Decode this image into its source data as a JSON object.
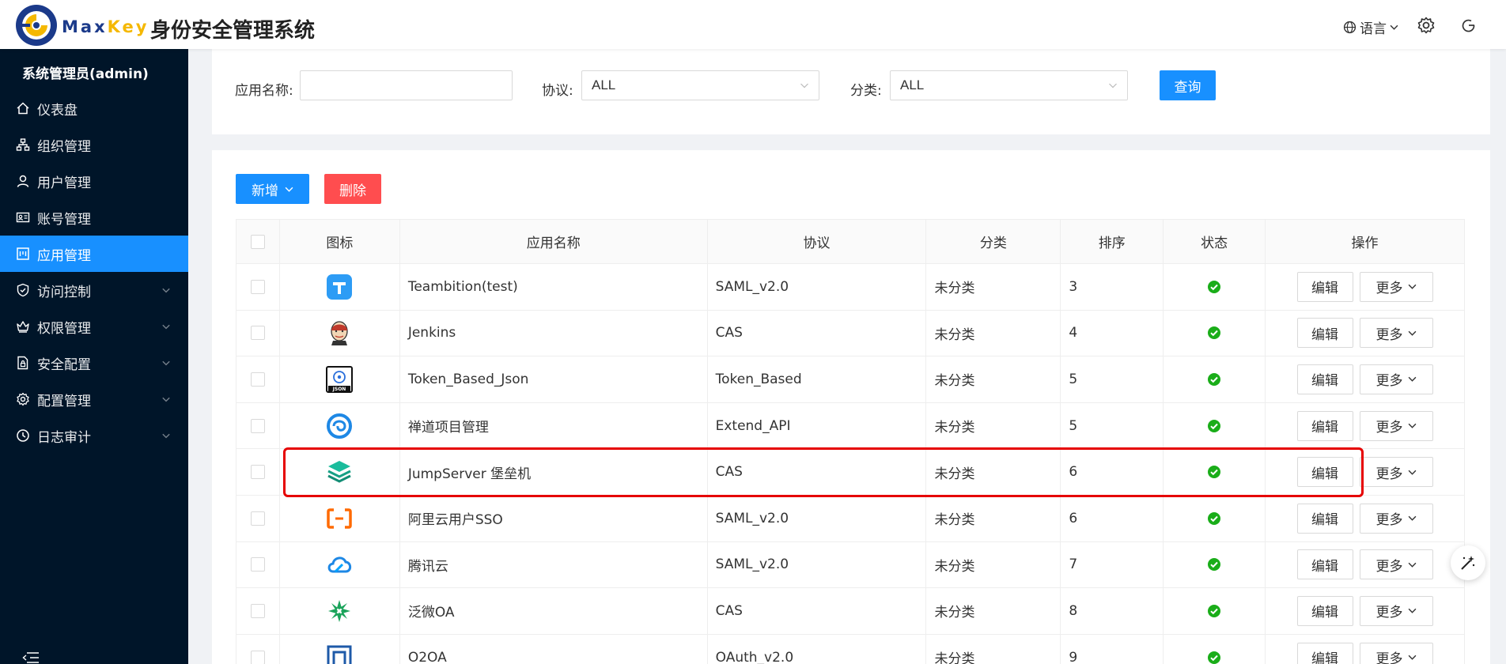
{
  "header": {
    "brand_max": "Max",
    "brand_key": "Key",
    "app_title": "身份安全管理系统",
    "language_label": "语言",
    "icons": [
      "globe-icon",
      "gear-icon",
      "logout-icon"
    ]
  },
  "sidebar": {
    "user": "系统管理员(admin)",
    "items": [
      {
        "label": "仪表盘",
        "icon": "home-icon",
        "expandable": false,
        "active": false
      },
      {
        "label": "组织管理",
        "icon": "org-icon",
        "expandable": false,
        "active": false
      },
      {
        "label": "用户管理",
        "icon": "user-icon",
        "expandable": false,
        "active": false
      },
      {
        "label": "账号管理",
        "icon": "idcard-icon",
        "expandable": false,
        "active": false
      },
      {
        "label": "应用管理",
        "icon": "app-icon",
        "expandable": false,
        "active": true
      },
      {
        "label": "访问控制",
        "icon": "shield-icon",
        "expandable": true,
        "active": false
      },
      {
        "label": "权限管理",
        "icon": "crown-icon",
        "expandable": true,
        "active": false
      },
      {
        "label": "安全配置",
        "icon": "file-lock-icon",
        "expandable": true,
        "active": false
      },
      {
        "label": "配置管理",
        "icon": "gear-icon",
        "expandable": true,
        "active": false
      },
      {
        "label": "日志审计",
        "icon": "clock-icon",
        "expandable": true,
        "active": false
      }
    ]
  },
  "search": {
    "app_name_label": "应用名称:",
    "app_name_value": "",
    "protocol_label": "协议:",
    "protocol_value": "ALL",
    "category_label": "分类:",
    "category_value": "ALL",
    "query_button": "查询"
  },
  "toolbar": {
    "add_button": "新增",
    "delete_button": "删除"
  },
  "table": {
    "headers": [
      "",
      "图标",
      "应用名称",
      "协议",
      "分类",
      "排序",
      "状态",
      "操作"
    ],
    "edit_label": "编辑",
    "more_label": "更多",
    "rows": [
      {
        "name": "Teambition(test)",
        "protocol": "SAML_v2.0",
        "category": "未分类",
        "sort": "3",
        "icon": "teambition-icon"
      },
      {
        "name": "Jenkins",
        "protocol": "CAS",
        "category": "未分类",
        "sort": "4",
        "icon": "jenkins-icon"
      },
      {
        "name": "Token_Based_Json",
        "protocol": "Token_Based",
        "category": "未分类",
        "sort": "5",
        "icon": "json-icon",
        "icon_text": "JSON"
      },
      {
        "name": "禅道项目管理",
        "protocol": "Extend_API",
        "category": "未分类",
        "sort": "5",
        "icon": "zentao-icon"
      },
      {
        "name": "JumpServer 堡垒机",
        "protocol": "CAS",
        "category": "未分类",
        "sort": "6",
        "icon": "jumpserver-icon"
      },
      {
        "name": "阿里云用户SSO",
        "protocol": "SAML_v2.0",
        "category": "未分类",
        "sort": "6",
        "icon": "aliyun-icon"
      },
      {
        "name": "腾讯云",
        "protocol": "SAML_v2.0",
        "category": "未分类",
        "sort": "7",
        "icon": "tencent-cloud-icon"
      },
      {
        "name": "泛微OA",
        "protocol": "CAS",
        "category": "未分类",
        "sort": "8",
        "icon": "weaver-icon"
      },
      {
        "name": "O2OA",
        "protocol": "OAuth_v2.0",
        "category": "未分类",
        "sort": "9",
        "icon": "o2oa-icon"
      }
    ]
  },
  "colors": {
    "primary": "#1890ff",
    "danger": "#ff4d4f",
    "sidebar_bg": "#001529",
    "status_ok": "#1aad19",
    "highlight": "#e60000"
  }
}
